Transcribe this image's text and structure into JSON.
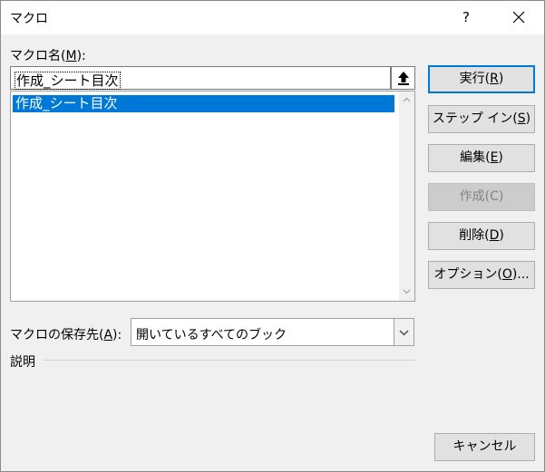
{
  "window": {
    "title": "マクロ",
    "help_label": "?"
  },
  "macro_name": {
    "label_prefix": "マクロ名(",
    "label_key": "M",
    "label_suffix": "):",
    "value": "作成_シート目次"
  },
  "macro_list": {
    "items": [
      "作成_シート目次"
    ],
    "selected_index": 0
  },
  "location": {
    "label_prefix": "マクロの保存先(",
    "label_key": "A",
    "label_suffix": "):",
    "selected": "開いているすべてのブック"
  },
  "description": {
    "label": "説明"
  },
  "buttons": {
    "run": {
      "prefix": "実行(",
      "key": "R",
      "suffix": ")"
    },
    "step_in": {
      "prefix": "ステップ イン(",
      "key": "S",
      "suffix": ")"
    },
    "edit": {
      "prefix": "編集(",
      "key": "E",
      "suffix": ")"
    },
    "create": {
      "label": "作成(C)"
    },
    "delete": {
      "prefix": "削除(",
      "key": "D",
      "suffix": ")"
    },
    "options": {
      "prefix": "オプション(",
      "key": "O",
      "suffix": ")..."
    },
    "cancel": {
      "label": "キャンセル"
    }
  },
  "icons": {
    "help": "help-icon",
    "close": "close-icon",
    "collapse": "upload-arrow-icon",
    "scroll_up": "chevron-up-icon",
    "scroll_down": "chevron-down-icon",
    "dropdown": "chevron-down-icon"
  },
  "colors": {
    "selection": "#0078d7",
    "default_border": "#0078d7",
    "dialog_bg": "#f0f0f0",
    "disabled_text": "#838383"
  }
}
